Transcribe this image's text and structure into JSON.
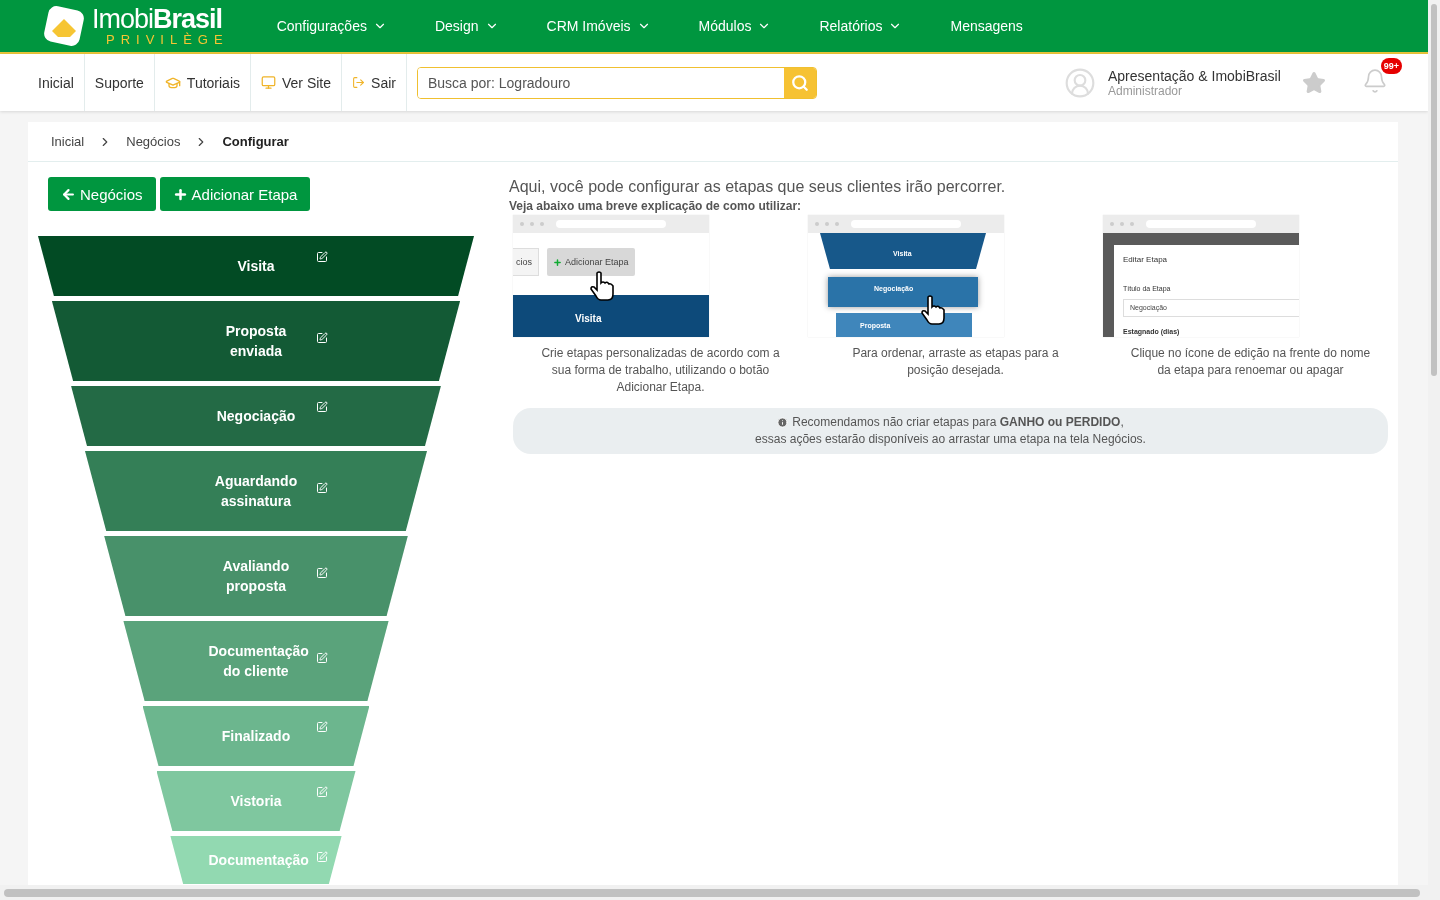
{
  "brand": {
    "name_light": "Imobi",
    "name_bold": "Brasil",
    "tagline": "PRIVILÈGE"
  },
  "top_menu": [
    {
      "label": "Configurações",
      "has_dropdown": true
    },
    {
      "label": "Design",
      "has_dropdown": true
    },
    {
      "label": "CRM Imóveis",
      "has_dropdown": true
    },
    {
      "label": "Módulos",
      "has_dropdown": true
    },
    {
      "label": "Relatórios",
      "has_dropdown": true
    },
    {
      "label": "Mensagens",
      "has_dropdown": false
    }
  ],
  "quick_links": [
    {
      "label": "Inicial"
    },
    {
      "label": "Suporte"
    },
    {
      "label": "Tutoriais"
    },
    {
      "label": "Ver Site"
    },
    {
      "label": "Sair"
    }
  ],
  "search": {
    "placeholder": "Busca por: Logradouro"
  },
  "user": {
    "name": "Apresentação & ImobiBrasil",
    "role": "Administrador"
  },
  "notifications": {
    "badge": "99+"
  },
  "breadcrumb": [
    {
      "label": "Inicial",
      "current": false
    },
    {
      "label": "Negócios",
      "current": false
    },
    {
      "label": "Configurar",
      "current": true
    }
  ],
  "actions": [
    {
      "label": "Negócios"
    },
    {
      "label": "Adicionar Etapa"
    }
  ],
  "stages": [
    {
      "label": "Visita",
      "color": "#024b24"
    },
    {
      "label": "Proposta enviada",
      "color": "#135a35"
    },
    {
      "label": "Negociação",
      "color": "#236a45"
    },
    {
      "label": "Aguardando assinatura",
      "color": "#347f57"
    },
    {
      "label": "Avaliando proposta",
      "color": "#48916a"
    },
    {
      "label": "Documentação do cliente",
      "color": "#5aa37b"
    },
    {
      "label": "Finalizado",
      "color": "#6cb68e"
    },
    {
      "label": "Vistoria",
      "color": "#7fc79f"
    },
    {
      "label": "Documentação",
      "color": "#92d9b1"
    }
  ],
  "intro": {
    "title": "Aqui, você pode configurar as etapas que seus clientes irão percorrer.",
    "subtitle": "Veja abaixo uma breve explicação de como utilizar:"
  },
  "tutorials": [
    {
      "kind": "add",
      "texts": [
        "cios",
        "Adicionar Etapa",
        "Visita"
      ],
      "caption": "Crie etapas personalizadas de acordo com a sua forma de trabalho, utilizando o botão Adicionar Etapa."
    },
    {
      "kind": "order",
      "texts": [
        "Visita",
        "Negociação",
        "Proposta"
      ],
      "caption": "Para ordenar, arraste as etapas para a posição desejada."
    },
    {
      "kind": "edit",
      "texts": [
        "Editar Etapa",
        "Título da Etapa",
        "Negociação",
        "Estagnado (dias)"
      ],
      "caption": "Clique no ícone de edição na frente do nome da etapa para renoemar ou apagar"
    }
  ],
  "notice": {
    "line1": "Recomendamos não criar etapas para **GANHO ou PERDIDO**,",
    "line2": "essas ações estarão disponíveis ao arrastar uma etapa na tela Negócios."
  }
}
